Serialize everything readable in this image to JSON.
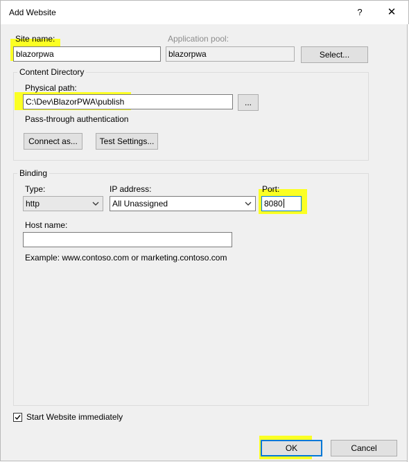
{
  "window": {
    "title": "Add Website",
    "help_label": "?",
    "close_label": "✕"
  },
  "site": {
    "name_label": "Site name:",
    "name_value": "blazorpwa",
    "app_pool_label": "Application pool:",
    "app_pool_value": "blazorpwa",
    "select_button": "Select..."
  },
  "content_directory": {
    "legend": "Content Directory",
    "physical_path_label": "Physical path:",
    "physical_path_value": "C:\\Dev\\BlazorPWA\\publish",
    "browse_button": "...",
    "pass_through_label": "Pass-through authentication",
    "connect_as_button": "Connect as...",
    "test_settings_button": "Test Settings..."
  },
  "binding": {
    "legend": "Binding",
    "type_label": "Type:",
    "type_value": "http",
    "ip_label": "IP address:",
    "ip_value": "All Unassigned",
    "port_label": "Port:",
    "port_value": "8080",
    "host_label": "Host name:",
    "host_value": "",
    "example_text": "Example: www.contoso.com or marketing.contoso.com"
  },
  "start": {
    "checked": true,
    "label": "Start Website immediately"
  },
  "footer": {
    "ok_button": "OK",
    "cancel_button": "Cancel"
  },
  "colors": {
    "highlight": "#fbff24",
    "focus_border": "#0078d7",
    "dialog_bg": "#f0f0f0"
  },
  "icons": {
    "dropdown": "chevron-down-icon",
    "checkbox": "checkmark-icon"
  }
}
